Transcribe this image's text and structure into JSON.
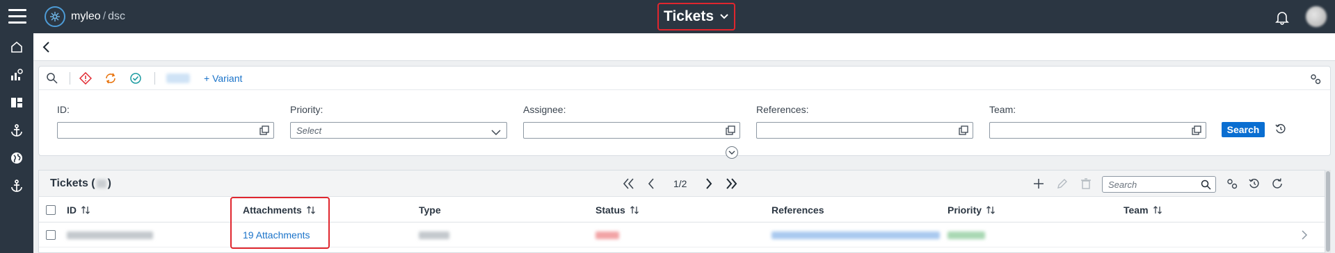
{
  "header": {
    "brand_name": "myleo",
    "brand_separator": "/",
    "brand_sub": "dsc",
    "app_title": "Tickets"
  },
  "filters": {
    "variant_link": "+ Variant",
    "fields": [
      {
        "label": "ID:",
        "value": ""
      },
      {
        "label": "Priority:",
        "placeholder": "Select"
      },
      {
        "label": "Assignee:",
        "value": ""
      },
      {
        "label": "References:",
        "value": ""
      },
      {
        "label": "Team:",
        "value": ""
      }
    ],
    "search_button": "Search"
  },
  "table": {
    "title": "Tickets (",
    "title_close": ")",
    "pagination": "1/2",
    "search_placeholder": "Search",
    "columns": [
      {
        "label": "ID",
        "sortable": true
      },
      {
        "label": "Attachments",
        "sortable": true
      },
      {
        "label": "Type",
        "sortable": false
      },
      {
        "label": "Status",
        "sortable": true
      },
      {
        "label": "References",
        "sortable": false
      },
      {
        "label": "Priority",
        "sortable": true
      },
      {
        "label": "Team",
        "sortable": true
      }
    ],
    "rows": [
      {
        "attachments": "19 Attachments"
      }
    ]
  },
  "colors": {
    "topbar": "#2b3642",
    "accent": "#0a6ed1",
    "highlight": "#e0262e",
    "link": "#1a73c9"
  },
  "icons": [
    "menu-icon",
    "logo-icon",
    "chevron-down-icon",
    "bell-icon",
    "home-icon",
    "analytics-icon",
    "dashboard-icon",
    "anchor-icon",
    "globe-icon",
    "back-icon",
    "search-icon",
    "alert-icon",
    "refresh-icon",
    "check-circle-icon",
    "settings-icon",
    "value-help-icon",
    "reset-icon",
    "expand-icon",
    "first-page-icon",
    "prev-page-icon",
    "next-page-icon",
    "last-page-icon",
    "add-icon",
    "edit-icon",
    "delete-icon",
    "sort-icon",
    "chevron-right-icon"
  ]
}
